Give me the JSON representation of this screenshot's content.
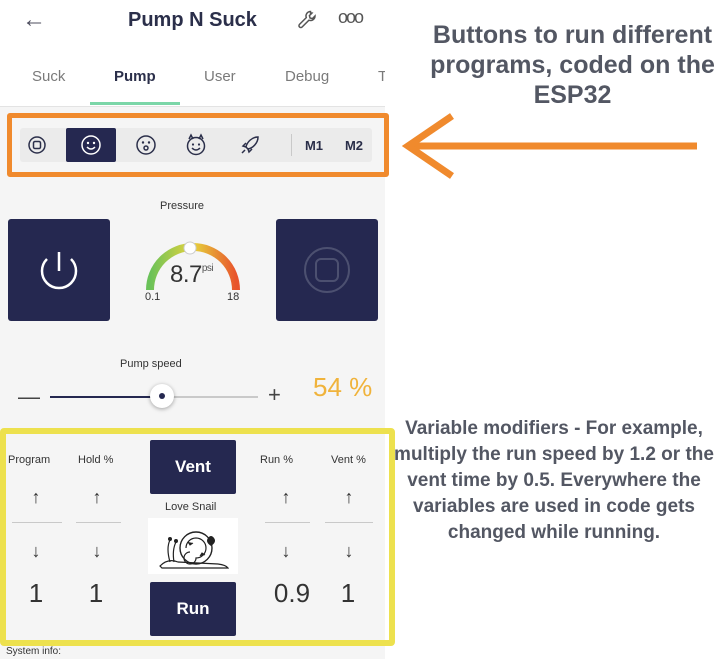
{
  "header": {
    "title": "Pump N Suck",
    "back_icon": "arrow-left-icon",
    "settings_icon": "wrench-icon",
    "more_icon": "more-dots-icon",
    "more_glyph": "ooo"
  },
  "tabs": [
    {
      "label": "Suck",
      "active": false
    },
    {
      "label": "Pump",
      "active": true
    },
    {
      "label": "User",
      "active": false
    },
    {
      "label": "Debug",
      "active": false
    },
    {
      "label": "T",
      "active": false
    }
  ],
  "program_selector": {
    "selected": "smile",
    "buttons": [
      {
        "icon": "stop-circle-icon"
      },
      {
        "icon": "smile-face-icon"
      },
      {
        "icon": "surprised-face-icon"
      },
      {
        "icon": "devil-face-icon"
      },
      {
        "icon": "rocket-icon"
      }
    ],
    "memory_buttons": [
      "M1",
      "M2"
    ]
  },
  "pressure": {
    "label": "Pressure",
    "value": "8.7",
    "unit": "psi",
    "min": "0.1",
    "max": "18"
  },
  "pump_speed": {
    "label": "Pump speed",
    "minus": "—",
    "plus": "+",
    "value_text": "54 %",
    "fraction": 0.54
  },
  "modifiers": {
    "columns": [
      {
        "header": "Program",
        "value": "1",
        "up": "↑",
        "down": "↓"
      },
      {
        "header": "Hold %",
        "value": "1",
        "up": "↑",
        "down": "↓"
      },
      {
        "header": "Run %",
        "value": "0.9",
        "up": "↑",
        "down": "↓"
      },
      {
        "header": "Vent %",
        "value": "1",
        "up": "↑",
        "down": "↓"
      }
    ],
    "vent_button": "Vent",
    "run_button": "Run",
    "image_label": "Love Snail"
  },
  "footer": {
    "system_info": "System info:"
  },
  "annotations": {
    "top": "Buttons to run different programs, coded on the ESP32",
    "bottom": "Variable modifiers - For example, multiply the run speed by 1.2 or the vent time by 0.5. Everywhere the variables are used in code gets changed while running."
  },
  "colors": {
    "primary_dark": "#252850",
    "accent_orange": "#f08a2d",
    "accent_yellow": "#ede14e",
    "speed_value": "#f0b33b",
    "tab_underline": "#7bd6a8"
  }
}
